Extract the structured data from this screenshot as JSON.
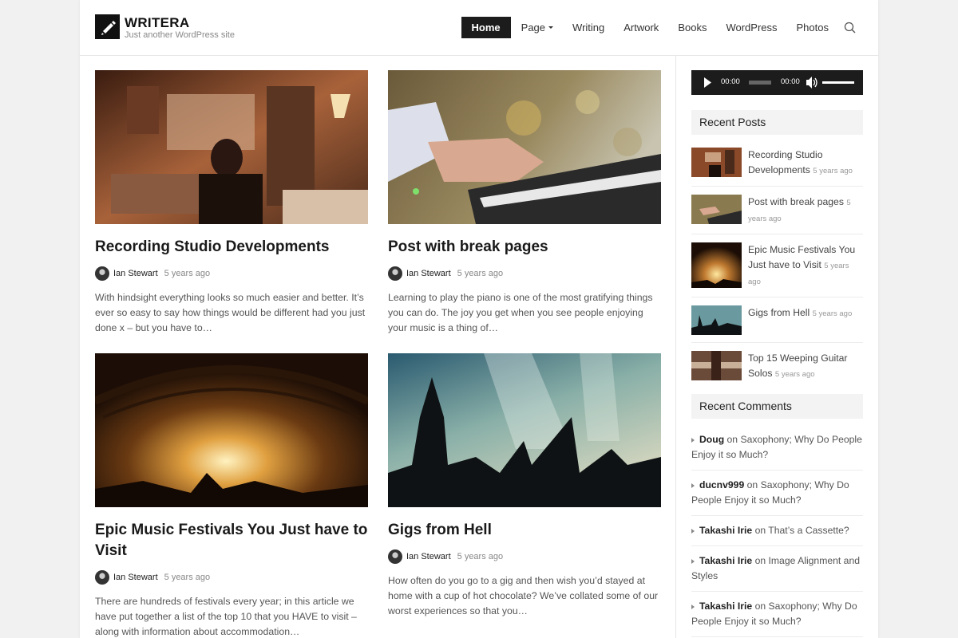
{
  "site": {
    "title": "WRITERA",
    "tagline": "Just another WordPress site",
    "logo_icon": "pencil-icon"
  },
  "nav": {
    "items": [
      {
        "label": "Home",
        "active": true
      },
      {
        "label": "Page",
        "dropdown": true
      },
      {
        "label": "Writing"
      },
      {
        "label": "Artwork"
      },
      {
        "label": "Books"
      },
      {
        "label": "WordPress"
      },
      {
        "label": "Photos"
      }
    ],
    "search_icon": "search-icon"
  },
  "posts": [
    {
      "title": "Recording Studio Developments",
      "author": "Ian Stewart",
      "time": "5 years ago",
      "excerpt": "With hindsight everything looks so much easier and better. It’s ever so easy to say how things would be different had you just done x – but you have to…"
    },
    {
      "title": "Post with break pages",
      "author": "Ian Stewart",
      "time": "5 years ago",
      "excerpt": "Learning to play the piano is one of the most gratifying things you can do. The joy you get when you see people enjoying your music is a thing of…"
    },
    {
      "title": "Epic Music Festivals You Just have to Visit",
      "author": "Ian Stewart",
      "time": "5 years ago",
      "excerpt": "There are hundreds of festivals every year; in this article we have put together a list of the top 10 that you HAVE to visit – along with information about accommodation…"
    },
    {
      "title": "Gigs from Hell",
      "author": "Ian Stewart",
      "time": "5 years ago",
      "excerpt": "How often do you go to a gig and then wish you’d stayed at home with a cup of hot chocolate? We’ve collated some of our worst experiences so that you…"
    }
  ],
  "audio": {
    "current_time": "00:00",
    "duration": "00:00"
  },
  "recent_posts": {
    "title": "Recent Posts",
    "items": [
      {
        "title": "Recording Studio Developments",
        "time": "5 years ago"
      },
      {
        "title": "Post with break pages",
        "time": "5 years ago"
      },
      {
        "title": "Epic Music Festivals You Just have to Visit",
        "time": "5 years ago"
      },
      {
        "title": "Gigs from Hell",
        "time": "5 years ago"
      },
      {
        "title": "Top 15 Weeping Guitar Solos",
        "time": "5 years ago"
      }
    ]
  },
  "recent_comments": {
    "title": "Recent Comments",
    "items": [
      {
        "author": "Doug",
        "on": "on",
        "post": "Saxophony; Why Do People Enjoy it so Much?"
      },
      {
        "author": "ducnv999",
        "on": "on",
        "post": "Saxophony; Why Do People Enjoy it so Much?"
      },
      {
        "author": "Takashi Irie",
        "on": "on",
        "post": "That’s a Cassette?"
      },
      {
        "author": "Takashi Irie",
        "on": "on",
        "post": "Image Alignment and Styles"
      },
      {
        "author": "Takashi Irie",
        "on": "on",
        "post": "Saxophony; Why Do People Enjoy it so Much?"
      }
    ]
  }
}
